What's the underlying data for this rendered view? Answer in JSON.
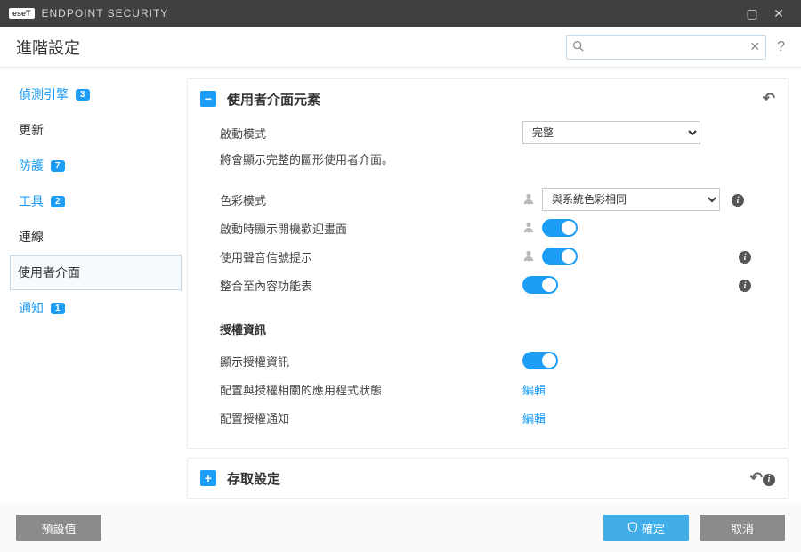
{
  "titlebar": {
    "product": "ENDPOINT SECURITY",
    "logo": "eseT"
  },
  "topbar": {
    "heading": "進階設定"
  },
  "sidebar": {
    "items": [
      {
        "label": "偵測引擎",
        "badge": "3",
        "highlight": true
      },
      {
        "label": "更新"
      },
      {
        "label": "防護",
        "badge": "7",
        "highlight": true
      },
      {
        "label": "工具",
        "badge": "2",
        "highlight": true
      },
      {
        "label": "連線"
      },
      {
        "label": "使用者介面",
        "selected": true
      },
      {
        "label": "通知",
        "badge": "1",
        "highlight": true
      }
    ]
  },
  "panels": {
    "ui_elements": {
      "title": "使用者介面元素",
      "startup_mode_label": "啟動模式",
      "startup_mode_value": "完整",
      "startup_mode_desc": "將會顯示完整的圖形使用者介面。",
      "color_mode_label": "色彩模式",
      "color_mode_value": "與系統色彩相同",
      "show_splash_label": "啟動時顯示開機歡迎畫面",
      "show_splash_on": true,
      "audio_hint_label": "使用聲音信號提示",
      "audio_hint_on": true,
      "integrate_context_label": "整合至內容功能表",
      "integrate_context_on": true,
      "license_section": "授權資訊",
      "show_license_label": "顯示授權資訊",
      "show_license_on": true,
      "config_app_states_label": "配置與授權相關的應用程式狀態",
      "config_notifications_label": "配置授權通知",
      "edit_link": "編輯"
    },
    "access_settings": {
      "title": "存取設定"
    }
  },
  "footer": {
    "default": "預設值",
    "ok": "確定",
    "cancel": "取消"
  }
}
